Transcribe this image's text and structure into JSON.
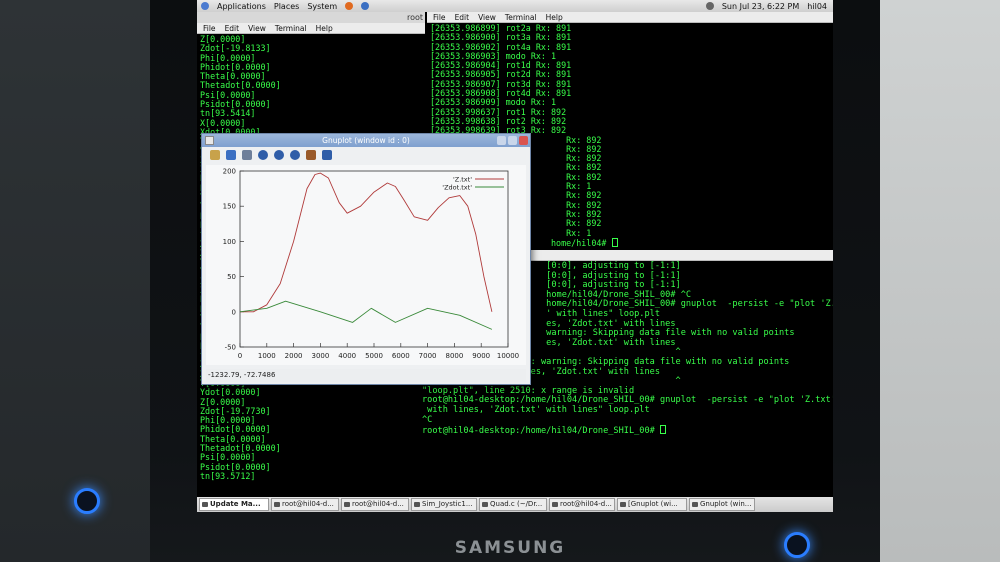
{
  "top_panel": {
    "menu": [
      "Applications",
      "Places",
      "System"
    ],
    "datetime": "Sun Jul 23,  6:22 PM",
    "user": "hil04"
  },
  "term_left": {
    "title": "root",
    "menu": [
      "File",
      "Edit",
      "View",
      "Terminal",
      "Help"
    ],
    "lines": [
      "Z[0.0000]",
      "Zdot[-19.8133]",
      "Phi[0.0000]",
      "Phidot[0.0000]",
      "Theta[0.0000]",
      "Thetadot[0.0000]",
      "Psi[0.0000]",
      "Psidot[0.0000]",
      "tn[93.5414]",
      "X[0.0000]",
      "Xdot[0.0000]",
      "Y[",
      "Yd",
      "Z[",
      "Zd",
      "Ph",
      "Ph",
      "Th",
      "Th",
      "Ps",
      "Ps",
      "tn",
      "X[",
      "Xd",
      "Y[",
      "Yd",
      "Z[",
      "Zd",
      "Ph",
      "Ph",
      "Th",
      "Th",
      "Ps",
      "Ps",
      "tn",
      "X[",
      "Xd",
      "Y[0.0000]",
      "Ydot[0.0000]",
      "Z[0.0000]",
      "Zdot[-19.7730]",
      "Phi[0.0000]",
      "Phidot[0.0000]",
      "Theta[0.0000]",
      "Thetadot[0.0000]",
      "Psi[0.0000]",
      "Psidot[0.0000]",
      "tn[93.5712]"
    ]
  },
  "term_right_top": {
    "menu": [
      "File",
      "Edit",
      "View",
      "Terminal",
      "Help"
    ],
    "lines": [
      "[26353.986899] rot2a Rx: 891",
      "[26353.986900] rot3a Rx: 891",
      "[26353.986902] rot4a Rx: 891",
      "[26353.986903] modo Rx: 1",
      "[26353.986904] rot1d Rx: 891",
      "[26353.986905] rot2d Rx: 891",
      "[26353.986907] rot3d Rx: 891",
      "[26353.986908] rot4d Rx: 891",
      "[26353.986909] modo Rx: 1",
      "[26353.998637] rot1 Rx: 892",
      "[26353.998638] rot2 Rx: 892",
      "[26353.998639] rot3 Rx: 892",
      "                           Rx: 892",
      "                           Rx: 892",
      "                           Rx: 892",
      "                           Rx: 892",
      "                           Rx: 892",
      "                           Rx: 1",
      "                           Rx: 892",
      "                           Rx: 892",
      "                           Rx: 892",
      "                           Rx: 892",
      "                           Rx: 1",
      "                        home/hil04# "
    ]
  },
  "term_right_bottom": {
    "title_fragment": "elp",
    "lines": [
      "                        [0:0], adjusting to [-1:1]",
      "                        [0:0], adjusting to [-1:1]",
      "                        [0:0], adjusting to [-1:1]",
      "",
      "                        home/hil04/Drone_SHIL_00# ^C",
      "                        home/hil04/Drone_SHIL_00# gnuplot  -persist -e \"plot 'Z.txt'",
      "                        ' with lines\" loop.plt",
      "",
      "                        es, 'Zdot.txt' with lines",
      "",
      "                        warning: Skipping data file with no valid points",
      "",
      "                        es, 'Zdot.txt' with lines",
      "                                                 ^",
      "\"loop.plt\", line 2510: warning: Skipping data file with no valid points",
      "",
      "plot 'Z.txt' with lines, 'Zdot.txt' with lines",
      "                                                 ^",
      "\"loop.plt\", line 2510: x range is invalid",
      "",
      "root@hil04-desktop:/home/hil04/Drone_SHIL_00# gnuplot  -persist -e \"plot 'Z.txt'",
      " with lines, 'Zdot.txt' with lines\" loop.plt",
      "^C",
      "root@hil04-desktop:/home/hil04/Drone_SHIL_00# "
    ]
  },
  "gnuplot": {
    "window_title": "Gnuplot (window id : 0)",
    "status": "-1232.79,  -72.7486",
    "toolbar_icons": [
      "copy-icon",
      "replot-icon",
      "grid-icon",
      "zoom-prev-icon",
      "zoom-next-icon",
      "zoom-icon",
      "options-icon",
      "help-icon"
    ]
  },
  "chart_data": {
    "type": "line",
    "xlim": [
      0,
      10000
    ],
    "ylim": [
      -50,
      200
    ],
    "x_ticks": [
      "0",
      "1000",
      "2000",
      "3000",
      "4000",
      "5000",
      "6000",
      "7000",
      "8000",
      "9000",
      "10000"
    ],
    "y_ticks": [
      "-50",
      "0",
      "50",
      "100",
      "150",
      "200"
    ],
    "legend_position": "top-right",
    "series": [
      {
        "name": "'Z.txt'",
        "color": "#b03a3a",
        "x": [
          0,
          500,
          1000,
          1500,
          2000,
          2500,
          2800,
          3000,
          3300,
          3700,
          4000,
          4500,
          5000,
          5500,
          5800,
          6100,
          6500,
          7000,
          7400,
          7800,
          8200,
          8500,
          8800,
          9100,
          9400
        ],
        "y": [
          0,
          0,
          10,
          40,
          100,
          175,
          195,
          197,
          190,
          155,
          140,
          150,
          170,
          183,
          178,
          160,
          135,
          130,
          148,
          162,
          165,
          150,
          110,
          50,
          0
        ]
      },
      {
        "name": "'Zdot.txt'",
        "color": "#3a8a3a",
        "x": [
          0,
          1000,
          1700,
          3000,
          4200,
          4900,
          5800,
          7000,
          8200,
          9400
        ],
        "y": [
          0,
          5,
          15,
          0,
          -15,
          5,
          -15,
          5,
          -5,
          -25
        ]
      }
    ]
  },
  "taskbar": {
    "tasks": [
      "Update Ma...",
      "root@hil04-d...",
      "root@hil04-d...",
      "Sim_Joystic1...",
      "Quad.c (~/Dr...",
      "root@hil04-d...",
      "[Gnuplot (wi...",
      "Gnuplot (win..."
    ],
    "active_index": 0
  },
  "monitor": {
    "brand": "SAMSUNG"
  }
}
